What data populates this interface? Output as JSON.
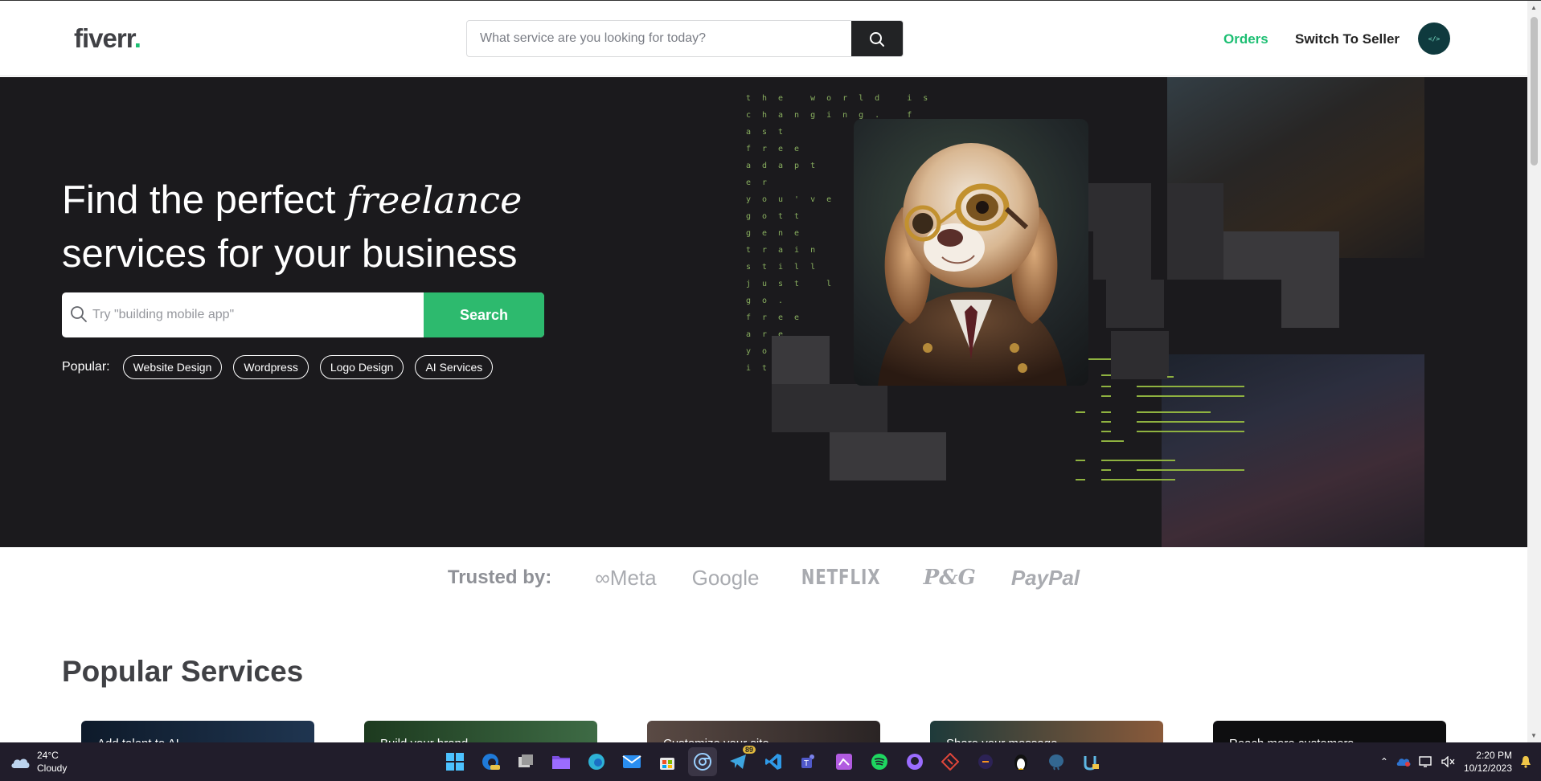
{
  "header": {
    "logo_text": "fiverr",
    "logo_dot": ".",
    "search_placeholder": "What service are you looking for today?",
    "nav_orders": "Orders",
    "nav_switch": "Switch To Seller",
    "avatar_text": "</>"
  },
  "hero": {
    "title_line1_part1": "Find the perfect ",
    "title_line1_em": "freelance",
    "title_line2": "services for your business",
    "search_placeholder": "Try \"building mobile app\"",
    "search_button": "Search",
    "popular_label": "Popular:",
    "popular_tags": [
      "Website Design",
      "Wordpress",
      "Logo Design",
      "AI Services"
    ],
    "code_lines": [
      "the world is",
      "changing. f",
      "ast",
      "free",
      "adapt",
      "er",
      "you've",
      "gott",
      "gene",
      "train",
      "still",
      "just l",
      "go.",
      "free",
      "are",
      "you",
      "it l"
    ]
  },
  "trusted": {
    "label": "Trusted by:",
    "brands": [
      "Meta",
      "Google",
      "NETFLIX",
      "P&G",
      "PayPal"
    ]
  },
  "popular_services": {
    "title": "Popular Services",
    "cards": [
      "Add talent to AI",
      "Build your brand",
      "Customize your site",
      "Share your message",
      "Reach more customers"
    ]
  },
  "taskbar": {
    "temp": "24°C",
    "condition": "Cloudy",
    "badge_count": "89",
    "time": "2:20 PM",
    "date": "10/12/2023"
  },
  "colors": {
    "brand_green": "#1dbf73",
    "hero_bg": "#1b1a1d",
    "search_btn": "#2dba6e"
  }
}
